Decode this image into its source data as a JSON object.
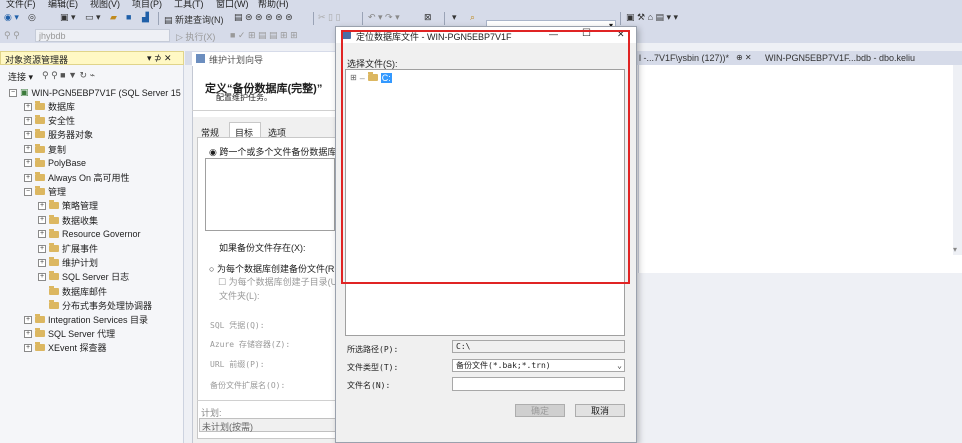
{
  "menubar": [
    "文件(F)",
    "编辑(E)",
    "视图(V)",
    "项目(P)",
    "工具(T)",
    "窗口(W)",
    "帮助(H)"
  ],
  "toolbar": {
    "new_query": "新建查询(N)",
    "database_combo": "jhybdb",
    "execute": "执行(X)"
  },
  "object_explorer": {
    "title": "对象资源管理器",
    "pin": "▾ ⊅ ✕",
    "connect": "连接 ▾",
    "server": "WIN-PGN5EBP7V1F (SQL Server 15",
    "items": [
      {
        "label": "数据库",
        "level": 1,
        "exp": "⊞"
      },
      {
        "label": "安全性",
        "level": 1,
        "exp": "⊞"
      },
      {
        "label": "服务器对象",
        "level": 1,
        "exp": "⊞"
      },
      {
        "label": "复制",
        "level": 1,
        "exp": "⊞"
      },
      {
        "label": "PolyBase",
        "level": 1,
        "exp": "⊞"
      },
      {
        "label": "Always On 高可用性",
        "level": 1,
        "exp": "⊞"
      },
      {
        "label": "管理",
        "level": 1,
        "exp": "⊟"
      },
      {
        "label": "策略管理",
        "level": 2,
        "exp": "⊞"
      },
      {
        "label": "数据收集",
        "level": 2,
        "exp": "⊞"
      },
      {
        "label": "Resource Governor",
        "level": 2,
        "exp": "⊞"
      },
      {
        "label": "扩展事件",
        "level": 2,
        "exp": "⊞"
      },
      {
        "label": "维护计划",
        "level": 2,
        "exp": "⊞"
      },
      {
        "label": "SQL Server 日志",
        "level": 2,
        "exp": "⊞"
      },
      {
        "label": "数据库邮件",
        "level": 2,
        "exp": ""
      },
      {
        "label": "分布式事务处理协调器",
        "level": 2,
        "exp": ""
      },
      {
        "label": "Integration Services 目录",
        "level": 1,
        "exp": "⊞"
      },
      {
        "label": "SQL Server 代理",
        "level": 1,
        "exp": "⊞"
      },
      {
        "label": "XEvent 探查器",
        "level": 1,
        "exp": "⊞"
      }
    ]
  },
  "tabs": {
    "tab1": "l -...7V1F\\ysbin (127))*",
    "tab1_close": "⊕ ✕",
    "tab2": "WIN-PGN5EBP7V1F...bdb - dbo.keliu"
  },
  "wizard": {
    "title": "维护计划向导",
    "heading": "定义“备份数据库(完整)”",
    "subheading": "配置维护任务。",
    "tabs": [
      "常规",
      "目标",
      "选项"
    ],
    "radio1": "跨一个或多个文件备份数据库",
    "if_exists": "如果备份文件存在(X):",
    "radio2": "为每个数据库创建备份文件(R",
    "subdir_checkbox": "为每个数据库创建子目录(U",
    "folder_label": "文件夹(L):",
    "sql_credential": "SQL 凭据(Q):",
    "azure_container": "Azure 存储容器(Z):",
    "url_prefix": "URL 前缀(P):",
    "ext_label": "备份文件扩展名(O):",
    "plan_label": "计划:",
    "plan_value": "未计划(按需)"
  },
  "dialog": {
    "title": "定位数据库文件 - WIN-PGN5EBP7V1F",
    "minimize": "—",
    "maximize": "☐",
    "close": "✕",
    "select_file_label": "选择文件(S):",
    "tree_root": "C:",
    "selected_path_label": "所选路径(P):",
    "selected_path_value": "C:\\",
    "file_type_label": "文件类型(T):",
    "file_type_value": "备份文件(*.bak;*.trn)",
    "file_name_label": "文件名(N):",
    "file_name_value": "",
    "ok": "确定",
    "cancel": "取消"
  },
  "colors": {
    "highlight": "#e02424",
    "accent": "#3399ff"
  }
}
